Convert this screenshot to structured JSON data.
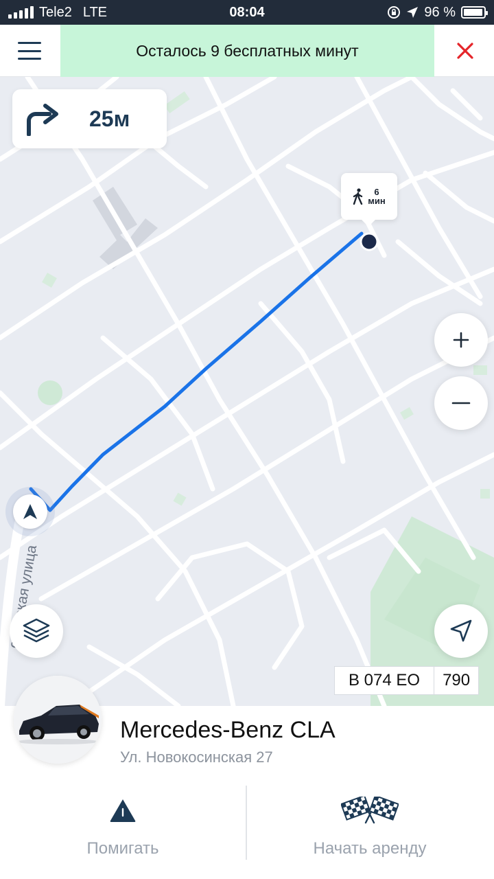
{
  "status_bar": {
    "carrier": "Tele2",
    "network": "LTE",
    "time": "08:04",
    "battery": "96 %",
    "battery_level": 0.96
  },
  "header": {
    "banner_text": "Осталось 9 бесплатных минут",
    "banner_color": "#c7f5d9",
    "close_color": "#e5252a"
  },
  "map": {
    "turn": {
      "icon": "turn-right-icon",
      "distance": "25м"
    },
    "walk": {
      "icon": "walking-person-icon",
      "minutes": "6",
      "unit": "мин"
    },
    "street_label": "осинская улица",
    "route_color": "#1a73e8",
    "plate": {
      "number": "В 074 ЕО",
      "region": "790"
    }
  },
  "car": {
    "name": "Mercedes-Benz CLA",
    "address": "Ул. Новокосинская 27"
  },
  "actions": {
    "blink_label": "Помигать",
    "start_label": "Начать аренду"
  }
}
